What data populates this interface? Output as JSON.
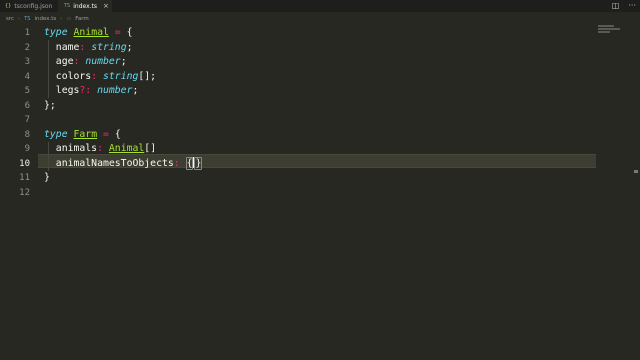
{
  "tabs": [
    {
      "icon": "{}",
      "label": "tsconfig.json",
      "active": false
    },
    {
      "icon": "TS",
      "label": "index.ts",
      "active": true
    }
  ],
  "breadcrumb": [
    "src",
    "index.ts",
    "Farm"
  ],
  "breadcrumb_icons": {
    "file": "TS",
    "symbol": "type-symbol-icon"
  },
  "editor": {
    "line_numbers": [
      "1",
      "2",
      "3",
      "4",
      "5",
      "6",
      "7",
      "8",
      "9",
      "10",
      "11",
      "12"
    ],
    "current_line": "10",
    "lines": [
      "type Animal = {",
      "  name: string;",
      "  age: number;",
      "  colors: string[];",
      "  legs?: number;",
      "};",
      "",
      "type Farm = {",
      "  animals: Animal[]",
      "  animalNamesToObjects: {}",
      "}",
      ""
    ]
  },
  "icons": [
    "split-editor-icon",
    "more-actions-icon"
  ],
  "colors": {
    "background": "#272822",
    "keyword": "#66d9ef",
    "type_name": "#a6e22e",
    "operator": "#f92672",
    "text": "#f8f8f2"
  }
}
